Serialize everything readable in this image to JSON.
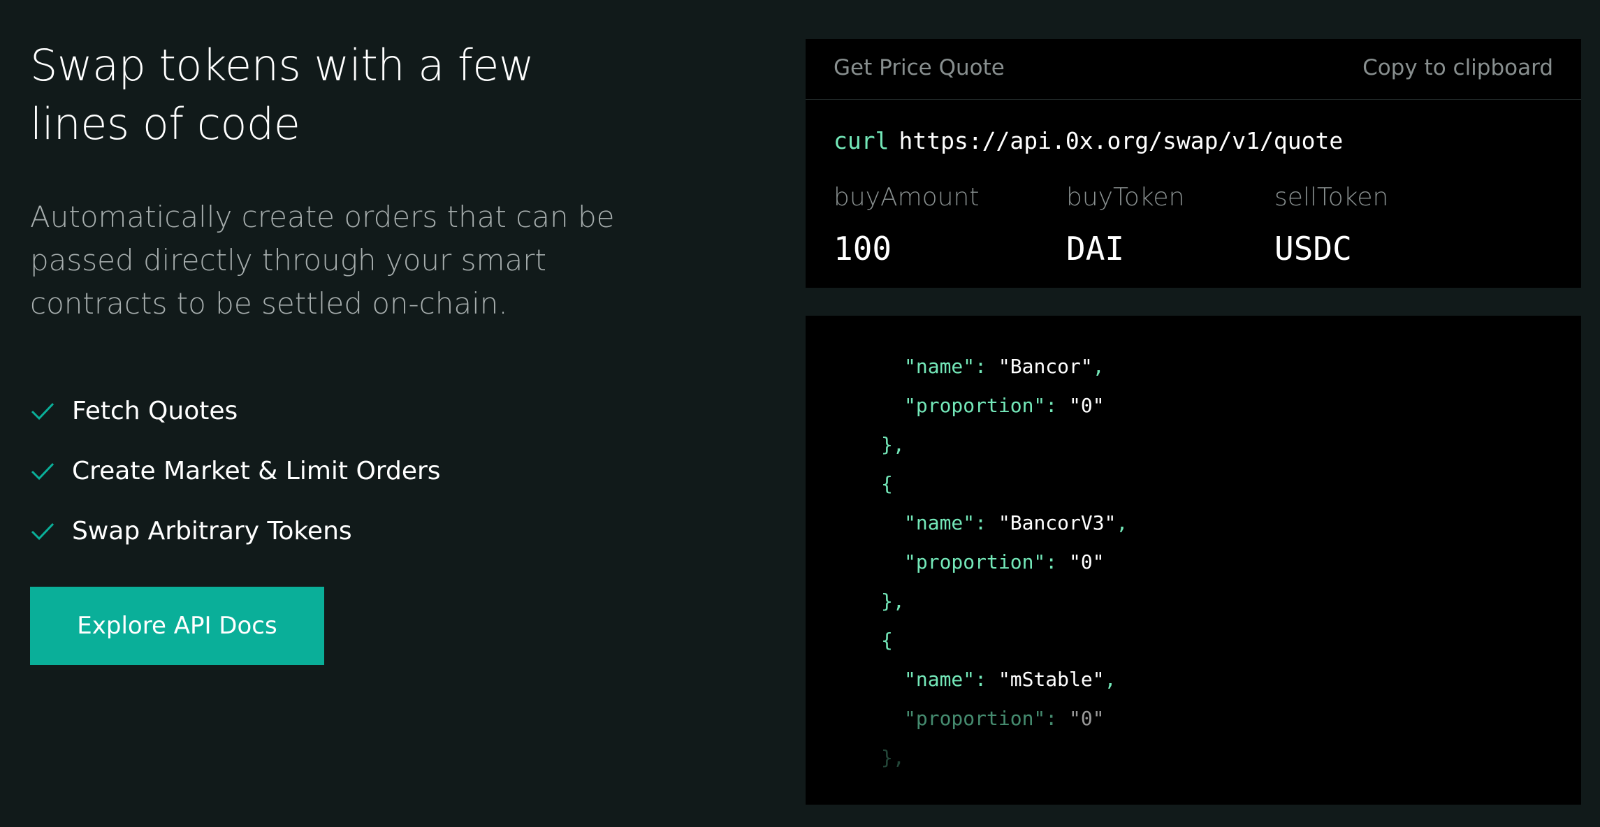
{
  "hero": {
    "headline": "Swap tokens with a few lines of code",
    "description": "Automatically create orders that can be passed directly through your smart contracts to be settled on-chain.",
    "features": [
      "Fetch Quotes",
      "Create Market & Limit Orders",
      "Swap Arbitrary Tokens"
    ],
    "cta_label": "Explore API Docs"
  },
  "quote": {
    "title": "Get Price Quote",
    "copy_label": "Copy to clipboard",
    "command": "curl",
    "url": "https://api.0x.org/swap/v1/quote",
    "params": [
      {
        "label": "buyAmount",
        "value": "100"
      },
      {
        "label": "buyToken",
        "value": "DAI"
      },
      {
        "label": "sellToken",
        "value": "USDC"
      }
    ]
  },
  "code": {
    "lines": [
      {
        "key": "\"name\"",
        "sep": ": ",
        "value": "\"Bancor\"",
        "tail": ","
      },
      {
        "key": "\"proportion\"",
        "sep": ": ",
        "value": "\"0\"",
        "tail": ""
      },
      {
        "punct": "},"
      },
      {
        "punct": "{"
      },
      {
        "key": "\"name\"",
        "sep": ": ",
        "value": "\"BancorV3\"",
        "tail": ","
      },
      {
        "key": "\"proportion\"",
        "sep": ": ",
        "value": "\"0\"",
        "tail": ""
      },
      {
        "punct": "},"
      },
      {
        "punct": "{"
      },
      {
        "key": "\"name\"",
        "sep": ": ",
        "value": "\"mStable\"",
        "tail": ","
      },
      {
        "key": "\"proportion\"",
        "sep": ": ",
        "value": "\"0\"",
        "tail": ""
      },
      {
        "punct": "},"
      }
    ]
  },
  "colors": {
    "background": "#111a1a",
    "accent": "#0aaf99",
    "code_key": "#74e8b9",
    "card": "#000000"
  },
  "icons": {
    "feature_bullet": "check-icon"
  }
}
